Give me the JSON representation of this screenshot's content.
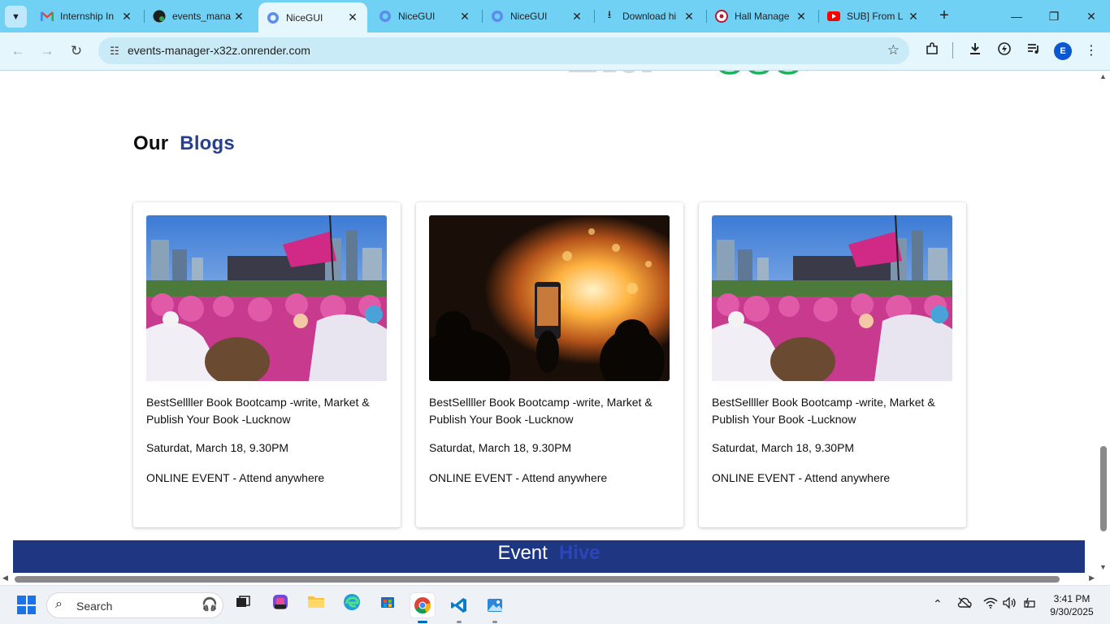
{
  "browser": {
    "tabs": [
      {
        "label": "Internship In",
        "favicon": "gmail-icon"
      },
      {
        "label": "events_mana",
        "favicon": "github-icon"
      },
      {
        "label": "NiceGUI",
        "favicon": "nicegui-icon",
        "active": true
      },
      {
        "label": "NiceGUI",
        "favicon": "nicegui-icon"
      },
      {
        "label": "NiceGUI",
        "favicon": "nicegui-icon"
      },
      {
        "label": "Download hi",
        "favicon": "download-icon"
      },
      {
        "label": "Hall Manage",
        "favicon": "hall-icon"
      },
      {
        "label": "SUB] From L",
        "favicon": "youtube-icon"
      }
    ],
    "url": "events-manager-x32z.onrender.com",
    "profile_initial": "E"
  },
  "page": {
    "section_title_word1": "Our",
    "section_title_word2": "Blogs",
    "cards": [
      {
        "image": "pink-rally-crowd",
        "title": "BestSellller Book Bootcamp -write, Market & Publish Your Book -Lucknow",
        "date": "Saturdat, March 18, 9.30PM",
        "mode": "ONLINE EVENT - Attend anywhere"
      },
      {
        "image": "bonfire-phone-photo",
        "title": "BestSellller Book Bootcamp -write, Market & Publish Your Book -Lucknow",
        "date": "Saturdat, March 18, 9.30PM",
        "mode": "ONLINE EVENT - Attend anywhere"
      },
      {
        "image": "pink-rally-crowd",
        "title": "BestSellller Book Bootcamp -write, Market & Publish Your Book -Lucknow",
        "date": "Saturdat, March 18, 9.30PM",
        "mode": "ONLINE EVENT - Attend anywhere"
      }
    ],
    "footer_word1": "Event",
    "footer_word2": "Hive",
    "colors": {
      "accent_blue": "#26408b",
      "footer_bg": "#1f3782",
      "logo_green": "#1bb35a"
    }
  },
  "taskbar": {
    "search_placeholder": "Search",
    "time": "3:41 PM",
    "date": "9/30/2025"
  }
}
